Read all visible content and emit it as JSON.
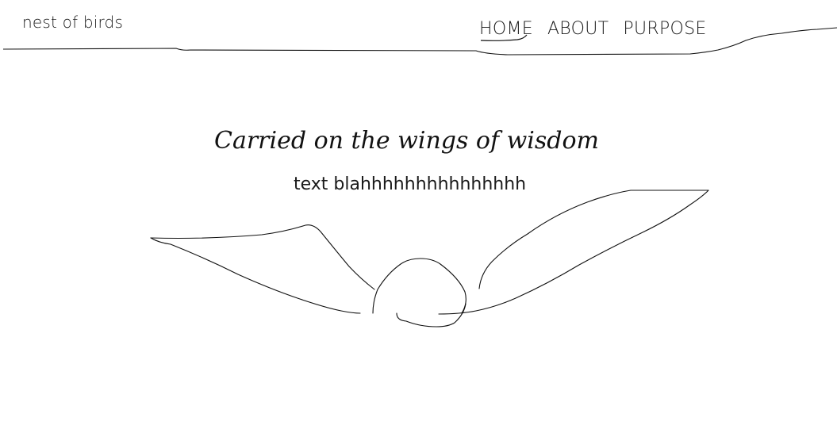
{
  "header": {
    "site_name": "nest of birds",
    "nav": [
      {
        "label": "HOME"
      },
      {
        "label": "ABOUT"
      },
      {
        "label": "PURPOSE"
      }
    ]
  },
  "hero": {
    "title": "Carried on the wings of wisdom",
    "text": "text blahhhhhhhhhhhhhhh"
  }
}
